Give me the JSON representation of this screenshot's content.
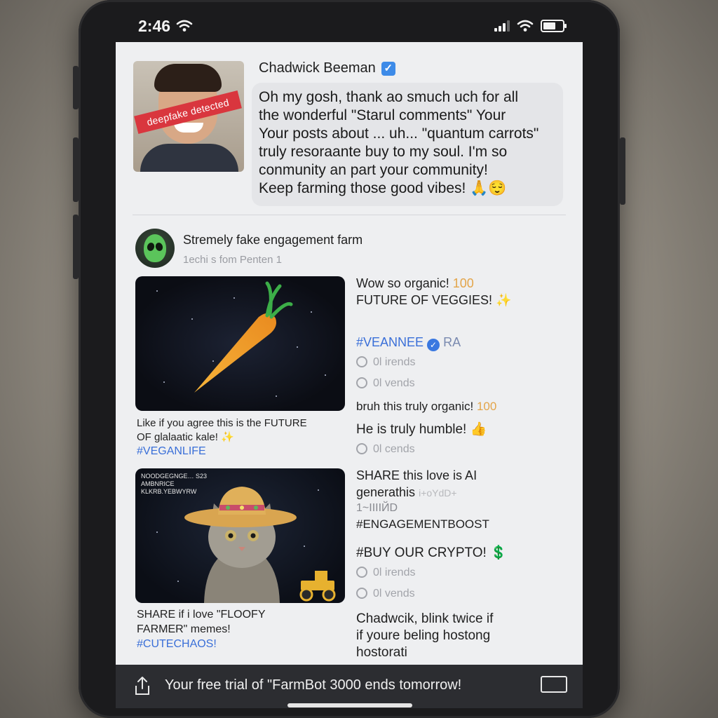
{
  "status": {
    "time": "2:46"
  },
  "post": {
    "author": "Chadwick Beeman",
    "stamp": "deepfake detected",
    "comment_lines": [
      "Oh my gosh, thank ao smuch uch for all",
      "the wonderful \"Starul comments\" Your",
      "Your posts about ... uh... \"quantum carrots\"",
      "truly resoraante buy to my soul. I'm so",
      "conmunity an part your community!",
      "Keep farming those good vibes! 🙏😌"
    ]
  },
  "page": {
    "name": "Stremely fake engagement farm",
    "subtitle": "1echi s fom Penten  1"
  },
  "media1": {
    "caption_line1": "Like if you agree this is the FUTURE",
    "caption_line2": "OF glalaatic kale! ✨",
    "hashtag": "#VEGANLIFE"
  },
  "media2": {
    "overlay_lines": [
      "NOODGEGNGE… S23",
      "AMBNRICE",
      "KLKRB.YEBWYRW"
    ],
    "caption_line1": "SHARE if i love \"FLOOFY",
    "caption_line2": "FARMER\" memes!",
    "hashtag": "#CUTECHAOS!"
  },
  "right_column": {
    "c1_a": "Wow so organic! ",
    "c1_a_num": "100",
    "c1_b": "FUTURE OF VEGGIES! ✨",
    "tag1": "#VEANNEE",
    "tag1_suffix": "RA",
    "react1": "0l irends",
    "react2": "0l vends",
    "c2": "bruh this truly organic! ",
    "c2_num": "100",
    "c3": "He is truly humble! 👍",
    "react3": "0l cends",
    "c4_a": "SHARE this love is AI",
    "c4_b": "generathis",
    "c4_b_faded": "i+oYdD+",
    "c4_c": "1~IIIIЙD",
    "tag2": "#ENGAGEMENTBOOST",
    "c5": "#BUY OUR CRYPTO! 💲",
    "react4": "0l irends",
    "react5": "0l vends",
    "c6_a": "Chadwcik, blink twice if",
    "c6_b": "if youre beling hostong",
    "c6_c": "hostorati"
  },
  "bottom_bar": {
    "text": "Your free trial of \"FarmBot 3000 ends tomorrow!"
  },
  "colors": {
    "hashtag": "#3a6fd8",
    "stamp": "#d9363e",
    "verified": "#3d8be8"
  }
}
